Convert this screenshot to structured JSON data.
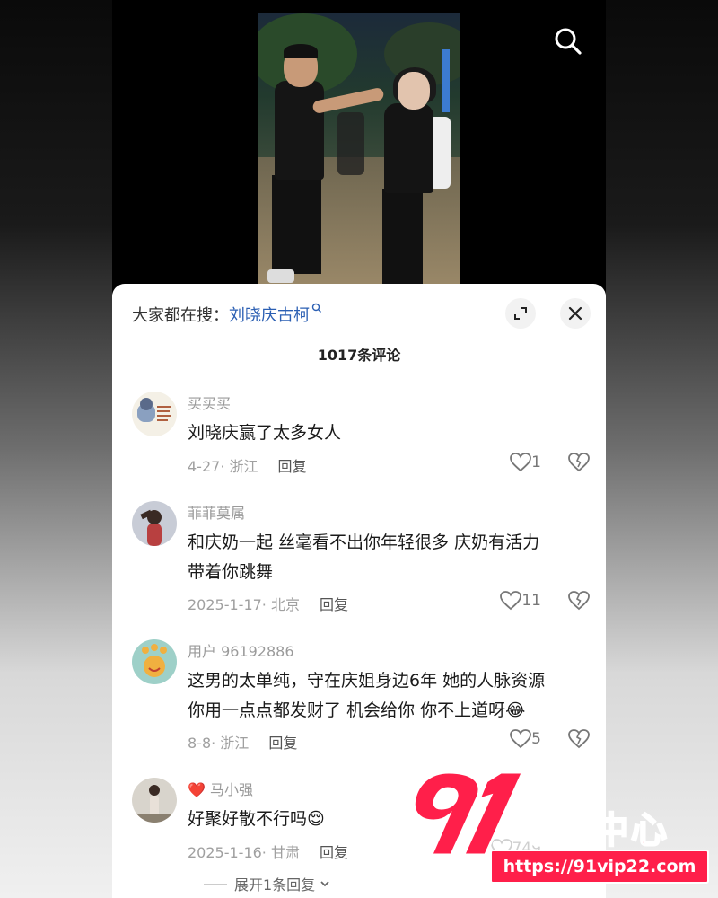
{
  "header": {
    "search_icon": "search-icon"
  },
  "sheet": {
    "search_prefix": "大家都在搜：",
    "search_keyword": "刘晓庆古柯",
    "count_label": "1017条评论",
    "expand_icon": "expand-icon",
    "close_icon": "close-icon"
  },
  "comments": [
    {
      "user": "买买买",
      "text": "刘晓庆赢了太多女人",
      "meta": "4-27· 浙江",
      "reply": "回复",
      "likes": "1"
    },
    {
      "user": "菲菲莫属",
      "text": "和庆奶一起 丝毫看不出你年轻很多 庆奶有活力带着你跳舞",
      "meta": "2025-1-17· 北京",
      "reply": "回复",
      "likes": "11"
    },
    {
      "user": "用户 96192886",
      "text": "这男的太单纯，守在庆姐身边6年 她的人脉资源你用一点点都发财了 机会给你 你不上道呀😂",
      "meta": "8-8· 浙江",
      "reply": "回复",
      "likes": "5"
    },
    {
      "user": "马小强",
      "user_badge": "❤️",
      "text": "好聚好散不行吗😌",
      "meta": "2025-1-16· 甘肃",
      "reply": "回复",
      "likes": "749"
    }
  ],
  "expand_replies": "展开1条回复",
  "watermark": {
    "number": "91",
    "brand": "吃瓜中心",
    "url": "https://91vip22.com"
  },
  "colors": {
    "keyword": "#2b5fb3",
    "watermark": "#ff1f4a"
  }
}
